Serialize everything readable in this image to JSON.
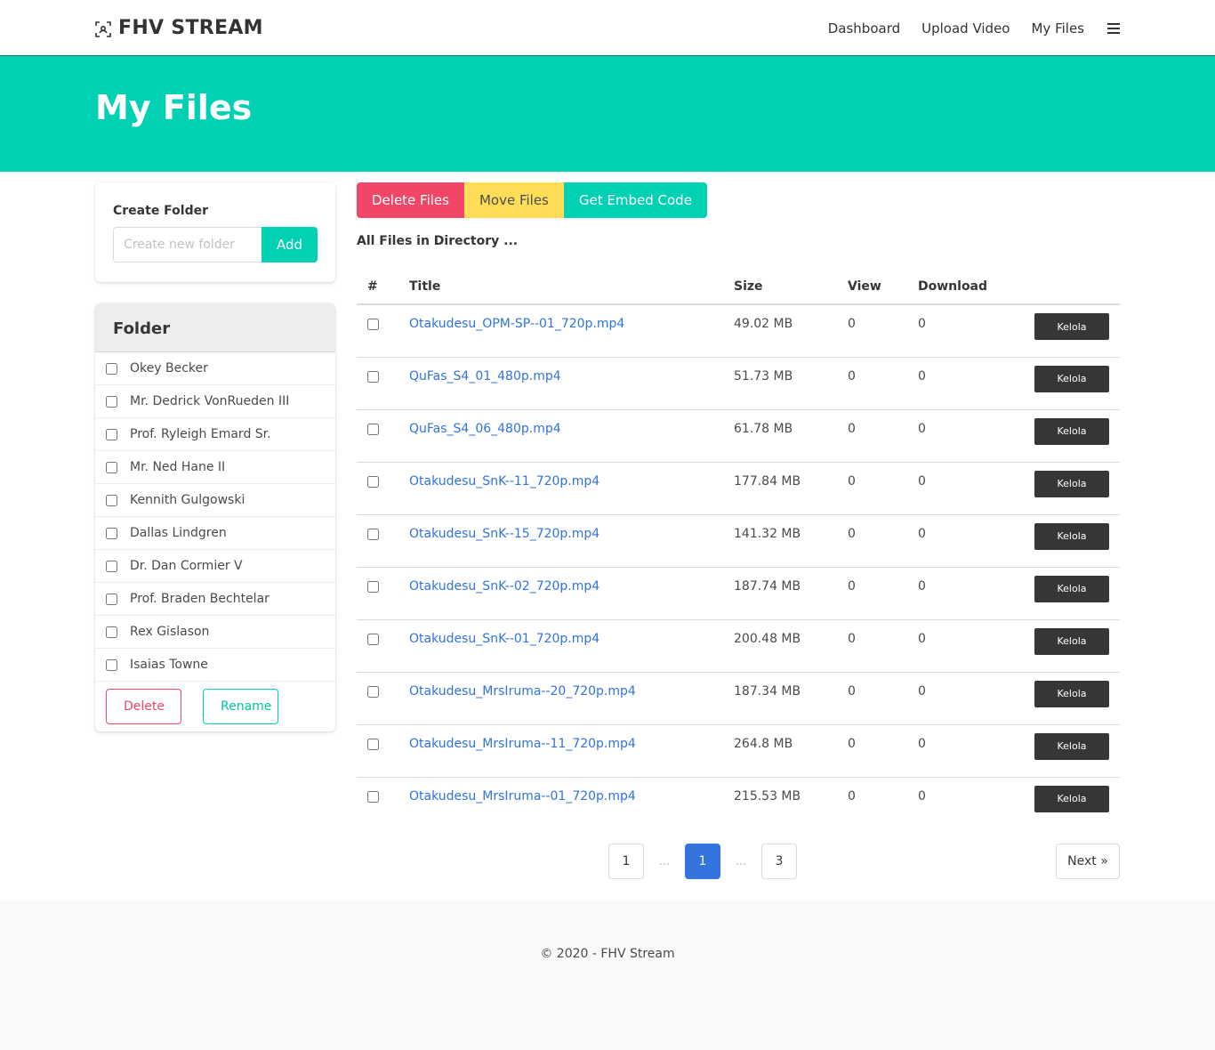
{
  "navbar": {
    "brand": "FHV STREAM",
    "brand_icon": "scan-icon",
    "links": [
      "Dashboard",
      "Upload Video",
      "My Files"
    ],
    "menu_icon": "hamburger-icon"
  },
  "hero": {
    "title": "My Files"
  },
  "create_folder": {
    "label": "Create Folder",
    "placeholder": "Create new folder",
    "add_label": "Add"
  },
  "folders": {
    "title": "Folder",
    "items": [
      "Okey Becker",
      "Mr. Dedrick VonRueden III",
      "Prof. Ryleigh Emard Sr.",
      "Mr. Ned Hane II",
      "Kennith Gulgowski",
      "Dallas Lindgren",
      "Dr. Dan Cormier V",
      "Prof. Braden Bechtelar",
      "Rex Gislason",
      "Isaias Towne"
    ],
    "delete_label": "Delete",
    "rename_label": "Rename"
  },
  "actions": {
    "delete_files": "Delete Files",
    "move_files": "Move Files",
    "embed_code": "Get Embed Code"
  },
  "directory_label": "All Files in Directory ...",
  "table": {
    "headers": {
      "num": "#",
      "title": "Title",
      "size": "Size",
      "view": "View",
      "download": "Download"
    },
    "action_label": "Kelola",
    "rows": [
      {
        "title": "Otakudesu_OPM-SP--01_720p.mp4",
        "size": "49.02 MB",
        "view": "0",
        "download": "0"
      },
      {
        "title": "QuFas_S4_01_480p.mp4",
        "size": "51.73 MB",
        "view": "0",
        "download": "0"
      },
      {
        "title": "QuFas_S4_06_480p.mp4",
        "size": "61.78 MB",
        "view": "0",
        "download": "0"
      },
      {
        "title": "Otakudesu_SnK--11_720p.mp4",
        "size": "177.84 MB",
        "view": "0",
        "download": "0"
      },
      {
        "title": "Otakudesu_SnK--15_720p.mp4",
        "size": "141.32 MB",
        "view": "0",
        "download": "0"
      },
      {
        "title": "Otakudesu_SnK--02_720p.mp4",
        "size": "187.74 MB",
        "view": "0",
        "download": "0"
      },
      {
        "title": "Otakudesu_SnK--01_720p.mp4",
        "size": "200.48 MB",
        "view": "0",
        "download": "0"
      },
      {
        "title": "Otakudesu_MrsIruma--20_720p.mp4",
        "size": "187.34 MB",
        "view": "0",
        "download": "0"
      },
      {
        "title": "Otakudesu_MrsIruma--11_720p.mp4",
        "size": "264.8 MB",
        "view": "0",
        "download": "0"
      },
      {
        "title": "Otakudesu_MrsIruma--01_720p.mp4",
        "size": "215.53 MB",
        "view": "0",
        "download": "0"
      }
    ]
  },
  "pagination": {
    "first": "1",
    "ellipsis": "...",
    "current": "1",
    "last": "3",
    "next": "Next »"
  },
  "footer": {
    "text": "© 2020 - FHV Stream"
  },
  "colors": {
    "primary": "#00d1b2",
    "danger": "#f14668",
    "warning": "#ffdd57",
    "link": "#3273dc",
    "dark": "#363636"
  }
}
